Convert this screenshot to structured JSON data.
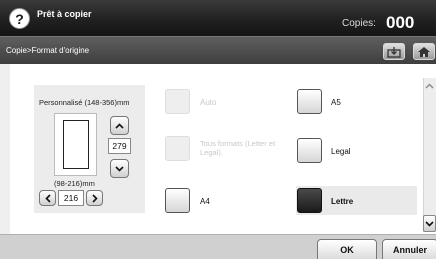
{
  "header": {
    "status": "Prêt à copier",
    "copies_label": "Copies:",
    "copies_value": "000"
  },
  "breadcrumb": "Copie>Format d'origine",
  "toolbar": {
    "icons": [
      "import-icon",
      "home-icon"
    ]
  },
  "custom_size": {
    "label": "Personnalisé (148-356)mm",
    "height_value": "279",
    "width_range": "(98-216)mm",
    "width_value": "216"
  },
  "sizes": {
    "auto": "Auto",
    "all_formats": "Tous formats (Letter et Legal).",
    "a4": "A4",
    "a5": "A5",
    "legal": "Legal",
    "letter": "Lettre",
    "selected": "Lettre"
  },
  "footer": {
    "ok": "OK",
    "cancel": "Annuler"
  },
  "colors": {
    "header_dark": "#1f1f1f",
    "selected_fill": "#1a1a1a"
  }
}
